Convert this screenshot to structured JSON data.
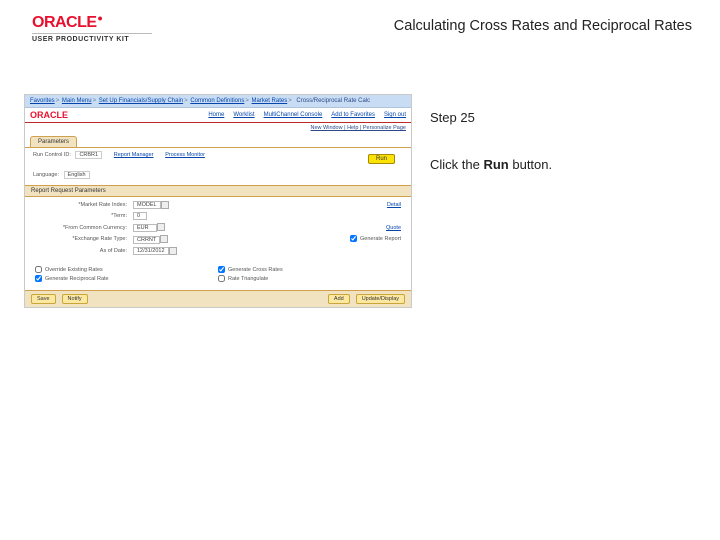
{
  "header": {
    "logo_word": "ORACLE",
    "upk_line": "USER PRODUCTIVITY KIT",
    "title": "Calculating Cross Rates and Reciprocal Rates"
  },
  "instructions": {
    "step_label": "Step 25",
    "body_pre": "Click the ",
    "body_strong": "Run",
    "body_post": " button."
  },
  "shot": {
    "breadcrumb": [
      "Favorites",
      "Main Menu",
      "Set Up Financials/Supply Chain",
      "Common Definitions",
      "Market Rates",
      "Cross/Reciprocal Rate Calc"
    ],
    "minilogo": "ORACLE",
    "menus": [
      "Home",
      "Worklist",
      "MultiChannel Console",
      "Add to Favorites",
      "Sign out"
    ],
    "window_line": "New Window | Help | Personalize Page",
    "tab": "Parameters",
    "form": {
      "run_control_id_lbl": "Run Control ID:",
      "run_control_id_val": "CRBR1",
      "report_manager": "Report Manager",
      "process_monitor": "Process Monitor",
      "run_btn": "Run",
      "language_lbl": "Language:",
      "language_val": "English"
    },
    "section_title": "Report Request Parameters",
    "params": {
      "market_rate_index_lbl": "*Market Rate Index:",
      "market_rate_index_val": "MODEL",
      "term_lbl": "*Term:",
      "term_val": "0",
      "from_cur_lbl": "*From Common Currency:",
      "from_cur_val": "EUR",
      "exch_rate_lbl": "*Exchange Rate Type:",
      "exch_rate_val": "CRRNT",
      "as_of_date_lbl": "As of Date:",
      "as_of_date_val": "12/31/2012",
      "right_col": {
        "detail": "Detail",
        "quote": "Quote",
        "generate_report": "Generate Report"
      }
    },
    "checks_left": {
      "override": "Override Existing Rates",
      "generate_reciprocal": "Generate Reciprocal Rate"
    },
    "checks_right": {
      "generate_cross": "Generate Cross Rates",
      "rate_triangulate": "Rate Triangulate"
    },
    "footer": {
      "save": "Save",
      "notify": "Notify",
      "add": "Add",
      "update": "Update/Display"
    }
  }
}
